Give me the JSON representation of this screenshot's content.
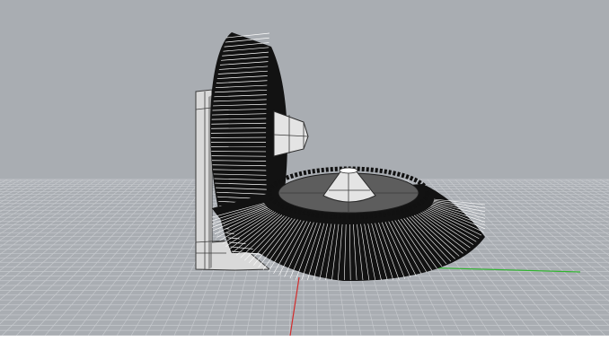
{
  "viewport": {
    "background_color": "#a9adb2",
    "grid_line_color": "#c6c9cd",
    "x_axis_color": "#d22c2c",
    "y_axis_color": "#2fb52f"
  },
  "model": {
    "tooth_color": "#121212",
    "edge_color": "#ffffff",
    "face_color": "#5d5d5d",
    "hub_color": "#e4e4e4",
    "bracket_color": "#d9d9d9"
  }
}
